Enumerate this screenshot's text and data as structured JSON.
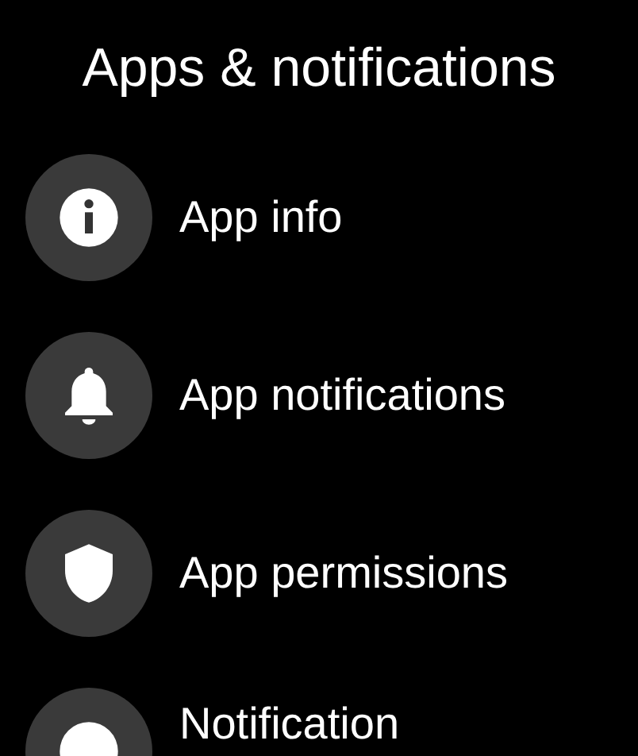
{
  "screen": {
    "title": "Apps & notifications"
  },
  "items": [
    {
      "label": "App info",
      "kind": "info"
    },
    {
      "label": "App notifications",
      "kind": "bell"
    },
    {
      "label": "App permissions",
      "kind": "shield"
    },
    {
      "label": "Notification",
      "kind": "partial"
    }
  ]
}
